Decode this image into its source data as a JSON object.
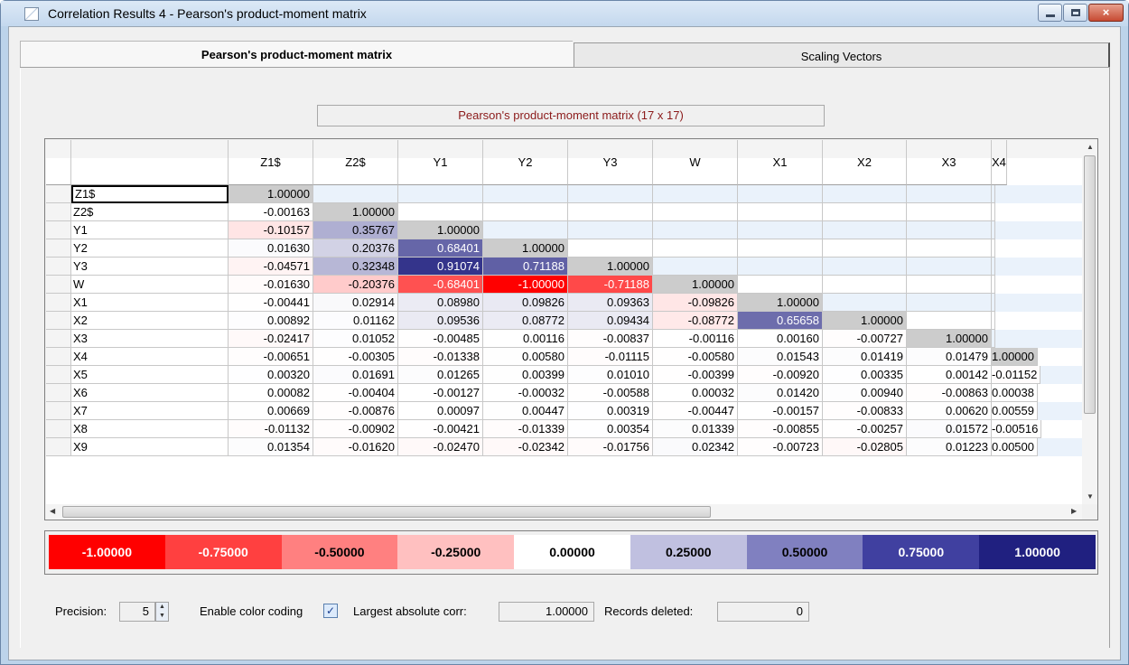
{
  "window": {
    "title": "Correlation Results 4 - Pearson's product-moment matrix",
    "close_glyph": "×"
  },
  "tabs": [
    "Pearson's product-moment matrix",
    "Scaling Vectors"
  ],
  "matrix_title": "Pearson's product-moment matrix (17 x 17)",
  "columns": [
    "Z1$",
    "Z2$",
    "Y1",
    "Y2",
    "Y3",
    "W",
    "X1",
    "X2",
    "X3",
    "X4"
  ],
  "rows": [
    {
      "label": "Z1$",
      "values": [
        "1.00000",
        "",
        "",
        "",
        "",
        "",
        "",
        "",
        "",
        ""
      ]
    },
    {
      "label": "Z2$",
      "values": [
        "-0.00163",
        "1.00000",
        "",
        "",
        "",
        "",
        "",
        "",
        "",
        ""
      ]
    },
    {
      "label": "Y1",
      "values": [
        "-0.10157",
        "0.35767",
        "1.00000",
        "",
        "",
        "",
        "",
        "",
        "",
        ""
      ]
    },
    {
      "label": "Y2",
      "values": [
        "0.01630",
        "0.20376",
        "0.68401",
        "1.00000",
        "",
        "",
        "",
        "",
        "",
        ""
      ]
    },
    {
      "label": "Y3",
      "values": [
        "-0.04571",
        "0.32348",
        "0.91074",
        "0.71188",
        "1.00000",
        "",
        "",
        "",
        "",
        ""
      ]
    },
    {
      "label": "W",
      "values": [
        "-0.01630",
        "-0.20376",
        "-0.68401",
        "-1.00000",
        "-0.71188",
        "1.00000",
        "",
        "",
        "",
        ""
      ]
    },
    {
      "label": "X1",
      "values": [
        "-0.00441",
        "0.02914",
        "0.08980",
        "0.09826",
        "0.09363",
        "-0.09826",
        "1.00000",
        "",
        "",
        ""
      ]
    },
    {
      "label": "X2",
      "values": [
        "0.00892",
        "0.01162",
        "0.09536",
        "0.08772",
        "0.09434",
        "-0.08772",
        "0.65658",
        "1.00000",
        "",
        ""
      ]
    },
    {
      "label": "X3",
      "values": [
        "-0.02417",
        "0.01052",
        "-0.00485",
        "0.00116",
        "-0.00837",
        "-0.00116",
        "0.00160",
        "-0.00727",
        "1.00000",
        ""
      ]
    },
    {
      "label": "X4",
      "values": [
        "-0.00651",
        "-0.00305",
        "-0.01338",
        "0.00580",
        "-0.01115",
        "-0.00580",
        "0.01543",
        "0.01419",
        "0.01479",
        "1.00000"
      ]
    },
    {
      "label": "X5",
      "values": [
        "0.00320",
        "0.01691",
        "0.01265",
        "0.00399",
        "0.01010",
        "-0.00399",
        "-0.00920",
        "0.00335",
        "0.00142",
        "-0.01152"
      ]
    },
    {
      "label": "X6",
      "values": [
        "0.00082",
        "-0.00404",
        "-0.00127",
        "-0.00032",
        "-0.00588",
        "0.00032",
        "0.01420",
        "0.00940",
        "-0.00863",
        "0.00038"
      ]
    },
    {
      "label": "X7",
      "values": [
        "0.00669",
        "-0.00876",
        "0.00097",
        "0.00447",
        "0.00319",
        "-0.00447",
        "-0.00157",
        "-0.00833",
        "0.00620",
        "0.00559"
      ]
    },
    {
      "label": "X8",
      "values": [
        "-0.01132",
        "-0.00902",
        "-0.00421",
        "-0.01339",
        "0.00354",
        "0.01339",
        "-0.00855",
        "-0.00257",
        "0.01572",
        "-0.00516"
      ]
    },
    {
      "label": "X9",
      "values": [
        "0.01354",
        "-0.01620",
        "-0.02470",
        "-0.02342",
        "-0.01756",
        "0.02342",
        "-0.00723",
        "-0.02805",
        "0.01223",
        "0.00500"
      ]
    }
  ],
  "legend": [
    {
      "label": "-1.00000",
      "bg": "#ff0000",
      "fg": "#ffffff"
    },
    {
      "label": "-0.75000",
      "bg": "#ff4040",
      "fg": "#ffffff"
    },
    {
      "label": "-0.50000",
      "bg": "#ff8080",
      "fg": "#000000"
    },
    {
      "label": "-0.25000",
      "bg": "#ffc0c0",
      "fg": "#000000"
    },
    {
      "label": "0.00000",
      "bg": "#ffffff",
      "fg": "#000000"
    },
    {
      "label": "0.25000",
      "bg": "#c0c0e0",
      "fg": "#000000"
    },
    {
      "label": "0.50000",
      "bg": "#8080c0",
      "fg": "#000000"
    },
    {
      "label": "0.75000",
      "bg": "#4040a0",
      "fg": "#ffffff"
    },
    {
      "label": "1.00000",
      "bg": "#202080",
      "fg": "#ffffff"
    }
  ],
  "colors": {
    "diagonal": "#cccccc",
    "row_stripe": "#eaf2fb",
    "header_bg": "#f4f4f4"
  },
  "footer": {
    "precision_label": "Precision:",
    "precision_value": "5",
    "color_coding_label": "Enable color coding",
    "color_coding_checked": true,
    "check_glyph": "✓",
    "largest_label": "Largest absolute corr:",
    "largest_value": "1.00000",
    "deleted_label": "Records deleted:",
    "deleted_value": "0"
  }
}
